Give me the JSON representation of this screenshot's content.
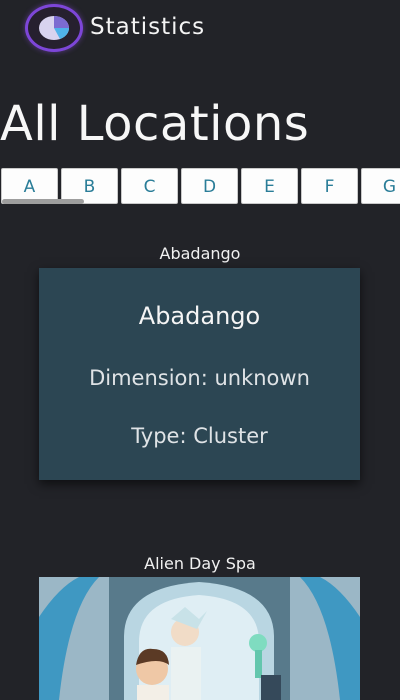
{
  "header": {
    "title": "Statistics",
    "logo_icon": "pie-chart-icon"
  },
  "page": {
    "title": "All Locations"
  },
  "letters": [
    "A",
    "B",
    "C",
    "D",
    "E",
    "F",
    "G"
  ],
  "locations": [
    {
      "caption": "Abadango",
      "name": "Abadango",
      "dimension": "Dimension: unknown",
      "type": "Type: Cluster"
    },
    {
      "caption": "Alien Day Spa"
    }
  ]
}
